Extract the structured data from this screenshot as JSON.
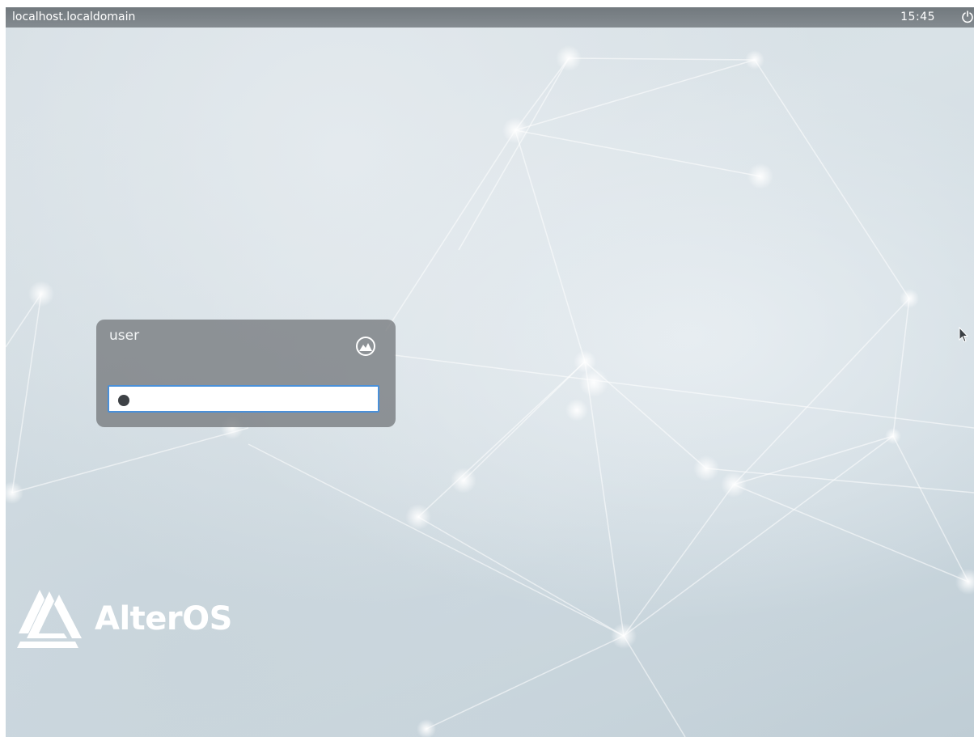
{
  "topbar": {
    "hostname": "localhost.localdomain",
    "clock": "15:45",
    "power_icon": "power-icon"
  },
  "login": {
    "username": "user",
    "session_icon": "session-logo-icon",
    "password_placeholder": "",
    "password_masked_chars": 1
  },
  "branding": {
    "name": "AlterOS",
    "logo_icon": "alteros-logo-icon"
  },
  "colors": {
    "topbar": "#6f767b",
    "card": "#767a7e",
    "focus_border": "#4a90d9",
    "text_light": "#ffffff"
  }
}
